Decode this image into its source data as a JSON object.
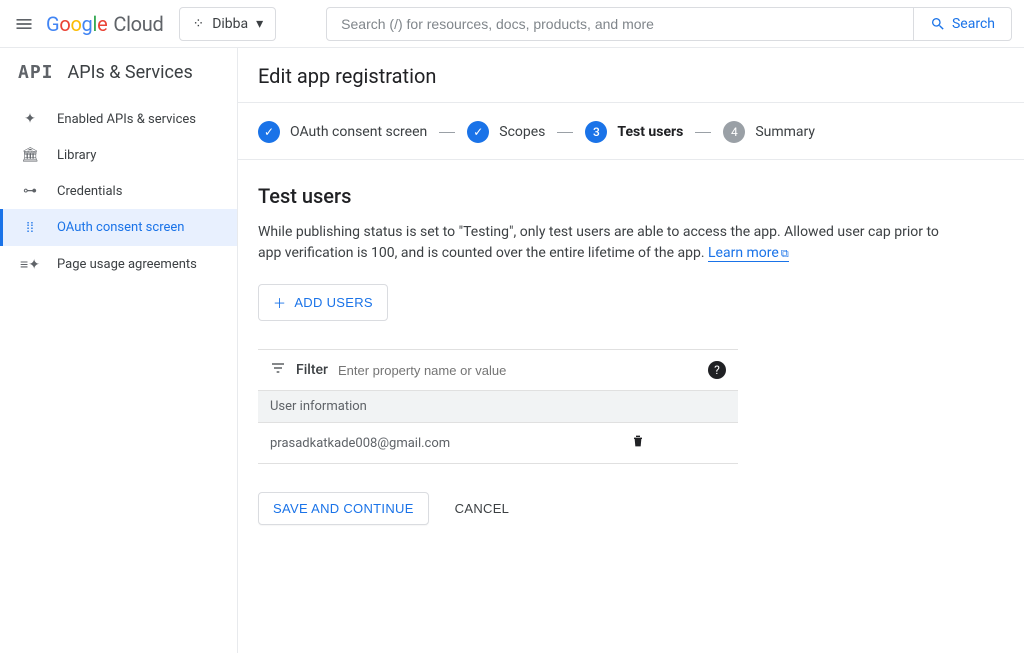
{
  "header": {
    "cloud_label": "Cloud",
    "project_name": "Dibba",
    "search_placeholder": "Search (/) for resources, docs, products, and more",
    "search_button": "Search"
  },
  "sidebar": {
    "product": "APIs & Services",
    "items": [
      {
        "label": "Enabled APIs & services"
      },
      {
        "label": "Library"
      },
      {
        "label": "Credentials"
      },
      {
        "label": "OAuth consent screen"
      },
      {
        "label": "Page usage agreements"
      }
    ]
  },
  "page": {
    "title": "Edit app registration"
  },
  "stepper": {
    "steps": [
      {
        "label": "OAuth consent screen"
      },
      {
        "label": "Scopes"
      },
      {
        "label": "Test users",
        "num": "3"
      },
      {
        "label": "Summary",
        "num": "4"
      }
    ]
  },
  "testusers": {
    "heading": "Test users",
    "body": "While publishing status is set to \"Testing\", only test users are able to access the app. Allowed user cap prior to app verification is 100, and is counted over the entire lifetime of the app. ",
    "learn_more": "Learn more",
    "add_button": "ADD USERS",
    "filter_label": "Filter",
    "filter_placeholder": "Enter property name or value",
    "column_header": "User information",
    "rows": [
      {
        "email": "prasadkatkade008@gmail.com"
      }
    ]
  },
  "actions": {
    "save": "SAVE AND CONTINUE",
    "cancel": "CANCEL"
  }
}
